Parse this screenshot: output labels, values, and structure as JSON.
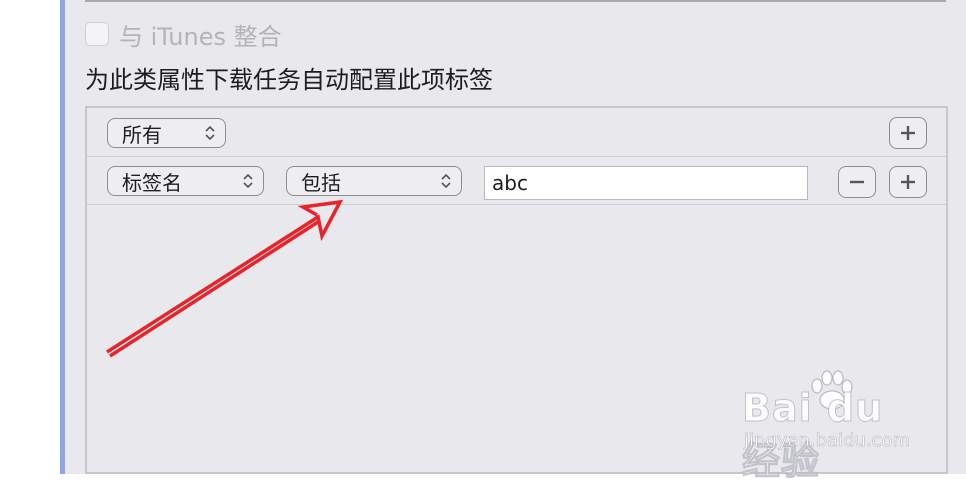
{
  "settings": {
    "itunes_checkbox": {
      "label": "与 iTunes 整合",
      "checked": false,
      "enabled": false
    },
    "heading": "为此类属性下载任务自动配置此项标签"
  },
  "rule_editor": {
    "match_popup": {
      "value": "所有"
    },
    "criteria": [
      {
        "attribute": "标签名",
        "operator": "包括",
        "value": "abc"
      }
    ],
    "add_icon": "plus-icon",
    "remove_icon": "minus-icon"
  },
  "annotation": {
    "color": "#e8232a",
    "shape": "arrow"
  },
  "watermark": {
    "brand_text": "Bai du 经验",
    "url": "jingyan.baidu.com"
  }
}
